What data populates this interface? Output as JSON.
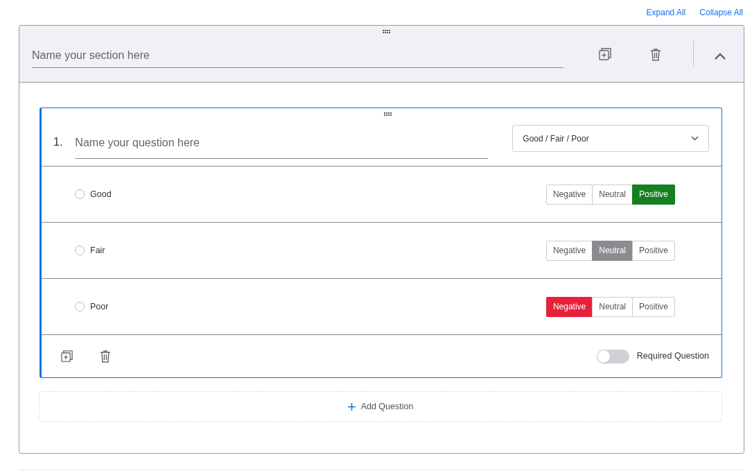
{
  "top_links": [
    "Expand All",
    "Collapse All"
  ],
  "section": {
    "title": {
      "placeholder": "Name your section here"
    },
    "expanded": true,
    "question": {
      "number": "1.",
      "title": {
        "placeholder": "Name your question here"
      },
      "type_select": {
        "value": "Good / Fair / Poor"
      },
      "options": [
        {
          "label": "Good",
          "checked": false,
          "sentiments": [
            {
              "label": "Negative",
              "kind": "negative",
              "selected": false
            },
            {
              "label": "Neutral",
              "kind": "neutral",
              "selected": false
            },
            {
              "label": "Positive",
              "kind": "positive",
              "selected": true
            }
          ]
        },
        {
          "label": "Fair",
          "checked": false,
          "sentiments": [
            {
              "label": "Negative",
              "kind": "negative",
              "selected": false
            },
            {
              "label": "Neutral",
              "kind": "neutral",
              "selected": true
            },
            {
              "label": "Positive",
              "kind": "positive",
              "selected": false
            }
          ]
        },
        {
          "label": "Poor",
          "checked": false,
          "sentiments": [
            {
              "label": "Negative",
              "kind": "negative",
              "selected": true
            },
            {
              "label": "Neutral",
              "kind": "neutral",
              "selected": false
            },
            {
              "label": "Positive",
              "kind": "positive",
              "selected": false
            }
          ]
        }
      ],
      "required": {
        "label": "Required Question",
        "on": false
      }
    },
    "add_question": "Add Question"
  }
}
